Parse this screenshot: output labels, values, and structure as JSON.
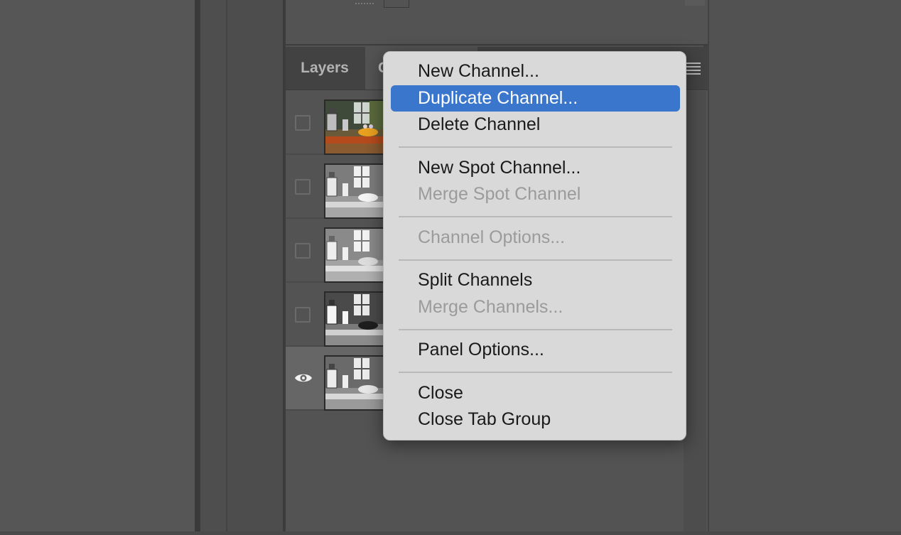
{
  "tabs": {
    "layers": "Layers",
    "channels": "C"
  },
  "channels": [
    {
      "visible": false,
      "thumb": "color"
    },
    {
      "visible": false,
      "thumb": "gray-light"
    },
    {
      "visible": false,
      "thumb": "gray-light"
    },
    {
      "visible": false,
      "thumb": "gray-dark"
    },
    {
      "visible": true,
      "thumb": "gray-mid",
      "active": true
    }
  ],
  "menu": {
    "items": [
      {
        "label": "New Channel...",
        "enabled": true
      },
      {
        "label": "Duplicate Channel...",
        "enabled": true,
        "highlighted": true
      },
      {
        "label": "Delete Channel",
        "enabled": true
      },
      {
        "label": "New Spot Channel...",
        "enabled": true
      },
      {
        "label": "Merge Spot Channel",
        "enabled": false
      },
      {
        "label": "Channel Options...",
        "enabled": false
      },
      {
        "label": "Split Channels",
        "enabled": true
      },
      {
        "label": "Merge Channels...",
        "enabled": false
      },
      {
        "label": "Panel Options...",
        "enabled": true
      },
      {
        "label": "Close",
        "enabled": true
      },
      {
        "label": "Close Tab Group",
        "enabled": true
      }
    ],
    "highlight_color": "#3b76cd"
  },
  "icons": {
    "panel_menu": "hamburger-icon",
    "visibility": "eye-icon"
  }
}
